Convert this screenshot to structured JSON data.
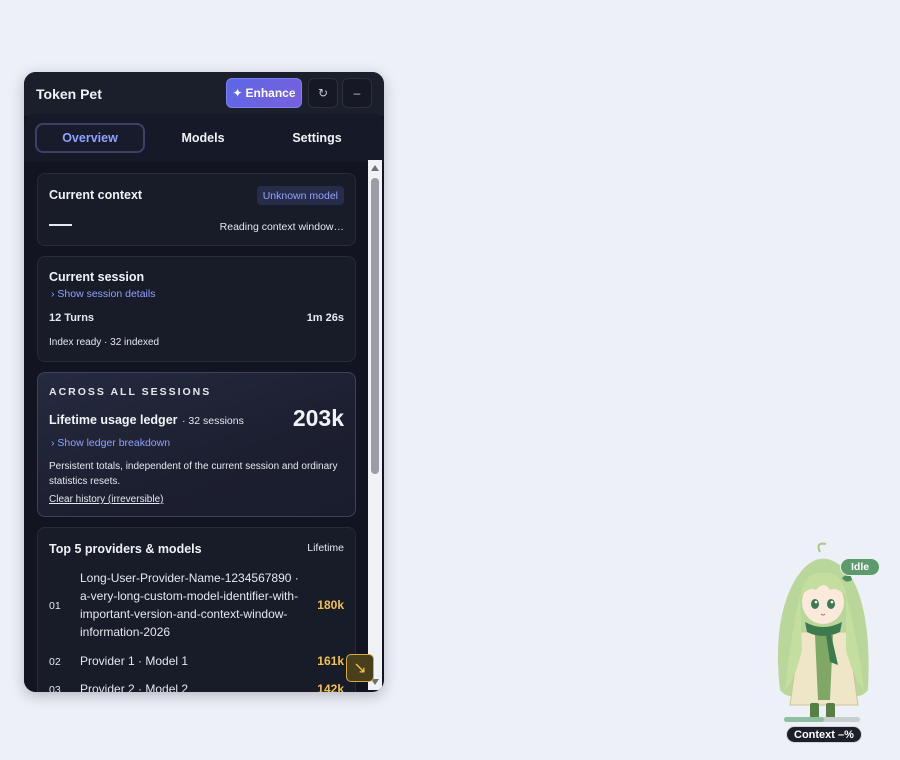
{
  "window": {
    "title": "Token Pet",
    "enhance_label": "Enhance",
    "enhance_icon": "sparkle-icon",
    "refresh_glyph": "↻",
    "minimize_glyph": "–"
  },
  "tabs": [
    {
      "label": "Overview",
      "active": true
    },
    {
      "label": "Models",
      "active": false
    },
    {
      "label": "Settings",
      "active": false
    }
  ],
  "current_context": {
    "title": "Current context",
    "model_badge": "Unknown model",
    "status": "Reading context window…"
  },
  "current_session": {
    "title": "Current session",
    "details_link": "› Show session details",
    "turns": "12 Turns",
    "duration": "1m 26s",
    "index_status": "Index ready · 32 indexed"
  },
  "lifetime": {
    "kicker": "ACROSS ALL SESSIONS",
    "title": "Lifetime usage ledger",
    "sessions": "· 32 sessions",
    "total": "203k",
    "breakdown_link": "› Show ledger breakdown",
    "description": "Persistent totals, independent of the current session and ordinary statistics resets.",
    "clear_link": "Clear history (irreversible)"
  },
  "top_providers": {
    "title": "Top 5 providers & models",
    "scope": "Lifetime",
    "items": [
      {
        "rank": "01",
        "name": "Long-User-Provider-Name-1234567890 · a-very-long-custom-model-identifier-with-important-version-and-context-window-information-2026",
        "value": "180k"
      },
      {
        "rank": "02",
        "name": "Provider 1 · Model 1",
        "value": "161k"
      },
      {
        "rank": "03",
        "name": "Provider 2 · Model 2",
        "value": "142k"
      }
    ]
  },
  "pet": {
    "status": "Idle",
    "context_label": "Context –%"
  },
  "colors": {
    "accent": "#8ea2ff",
    "value_gold": "#f2c04f",
    "panel_bg": "#121521",
    "idle_green": "#5d9a6e"
  }
}
